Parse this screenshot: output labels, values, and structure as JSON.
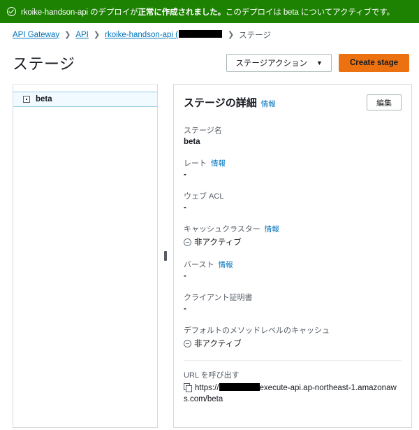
{
  "banner": {
    "icon": "check-circle-icon",
    "text_before": "rkoike-handson-api のデプロイが",
    "text_strong": "正常に作成されました。",
    "text_after": "このデプロイは beta についてアクティブです。",
    "color": "#1d8102"
  },
  "breadcrumb": {
    "items": [
      {
        "label": "API Gateway",
        "link": true
      },
      {
        "label": "API",
        "link": true
      },
      {
        "label": "rkoike-handson-api (",
        "link": true,
        "redacted": true
      },
      {
        "label": "ステージ",
        "link": false
      }
    ],
    "separator": "❯"
  },
  "header": {
    "title": "ステージ",
    "stage_action_label": "ステージアクション",
    "stage_action_caret": "▼",
    "create_stage_label": "Create stage",
    "primary_color": "#ec7211"
  },
  "tree": {
    "items": [
      {
        "label": "beta",
        "selected": true,
        "toggle_icon": "expand-box-icon"
      }
    ]
  },
  "detail": {
    "title": "ステージの詳細",
    "info_label": "情報",
    "edit_label": "編集",
    "fields": [
      {
        "label": "ステージ名",
        "info": false,
        "value": "beta",
        "icon": null,
        "bold": true
      },
      {
        "label": "レート",
        "info": true,
        "value": "-",
        "icon": null,
        "bold": true
      },
      {
        "label": "ウェブ ACL",
        "info": false,
        "value": "-",
        "icon": null,
        "bold": true
      },
      {
        "label": "キャッシュクラスター",
        "info": true,
        "value": "非アクティブ",
        "icon": "minus-circle-icon",
        "bold": false
      },
      {
        "label": "バースト",
        "info": true,
        "value": "-",
        "icon": null,
        "bold": true
      },
      {
        "label": "クライアント証明書",
        "info": false,
        "value": "-",
        "icon": null,
        "bold": true
      },
      {
        "label": "デフォルトのメソッドレベルのキャッシュ",
        "info": false,
        "value": "非アクティブ",
        "icon": "minus-circle-icon",
        "bold": false
      }
    ],
    "url_section": {
      "label": "URL を呼び出す",
      "copy_icon": "copy-icon",
      "url_prefix": "https://",
      "url_redacted": true,
      "url_suffix": "execute-api.ap-northeast-1.amazonaws.com/beta"
    }
  },
  "splitter": {
    "handle_icon": "drag-handle-icon"
  }
}
